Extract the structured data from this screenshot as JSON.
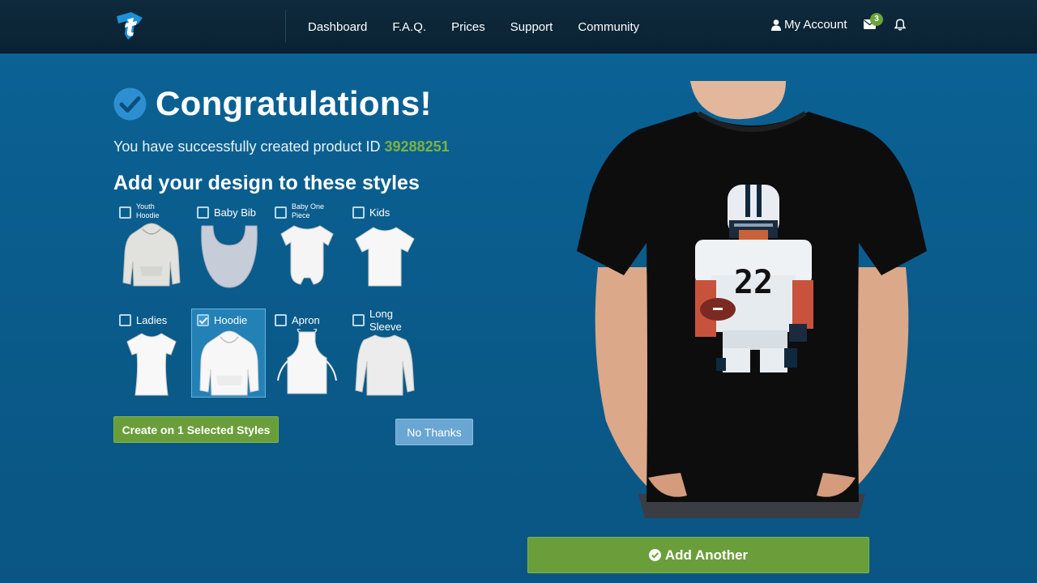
{
  "nav": {
    "links": [
      "Dashboard",
      "F.A.Q.",
      "Prices",
      "Support",
      "Community"
    ],
    "account_label": "My Account",
    "mail_count": "3"
  },
  "main": {
    "heading": "Congratulations!",
    "success_text": "You have successfully created product ID ",
    "product_id": "39288251",
    "styles_title": "Add your design to these styles",
    "styles": [
      {
        "label": "Youth Hoodie",
        "checked": false
      },
      {
        "label": "Baby Bib",
        "checked": false
      },
      {
        "label": "Baby One Piece",
        "checked": false
      },
      {
        "label": "Kids",
        "checked": false
      },
      {
        "label": "Ladies",
        "checked": false
      },
      {
        "label": "Hoodie",
        "checked": true
      },
      {
        "label": "Apron",
        "checked": false
      },
      {
        "label": "Long Sleeve",
        "checked": false
      }
    ],
    "create_button": "Create on 1 Selected Styles",
    "no_thanks_button": "No Thanks",
    "add_another_button": "Add Another"
  },
  "preview": {
    "jersey_number": "22"
  },
  "colors": {
    "accent_green": "#6a9e3a",
    "product_id_green": "#7cb342",
    "page_blue": "#0b6396",
    "navbar": "#0e2a3c"
  },
  "icons": [
    "teepublic-logo-icon",
    "user-icon",
    "envelope-icon",
    "bell-icon",
    "check-circle-icon",
    "checkbox-check-icon"
  ]
}
